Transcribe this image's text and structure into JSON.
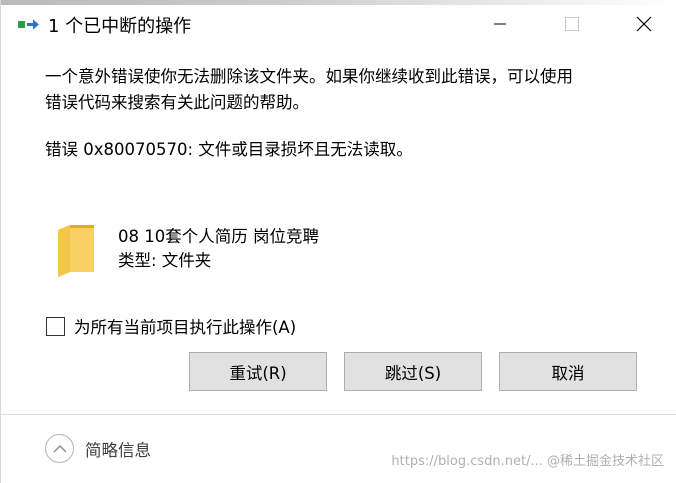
{
  "window": {
    "title": "1 个已中断的操作",
    "minimize_label": "Minimize",
    "maximize_label": "Maximize",
    "close_label": "Close"
  },
  "message": {
    "line1": "一个意外错误使你无法删除该文件夹。如果你继续收到此错误，可以使用",
    "line2": "错误代码来搜索有关此问题的帮助。",
    "error": "错误 0x80070570: 文件或目录损坏且无法读取。"
  },
  "item": {
    "name": "08 10套个人简历 岗位竞聘",
    "type": "类型: 文件夹",
    "icon": "folder-icon"
  },
  "checkbox": {
    "label": "为所有当前项目执行此操作(A)",
    "checked": false
  },
  "buttons": {
    "retry": "重试(R)",
    "skip": "跳过(S)",
    "cancel": "取消"
  },
  "footer": {
    "details": "简略信息"
  },
  "watermark": "https://blog.csdn.net/...  @稀土掘金技术社区",
  "colors": {
    "button_bg": "#e1e1e1",
    "button_border": "#adadad",
    "folder": "#f5c84c"
  }
}
